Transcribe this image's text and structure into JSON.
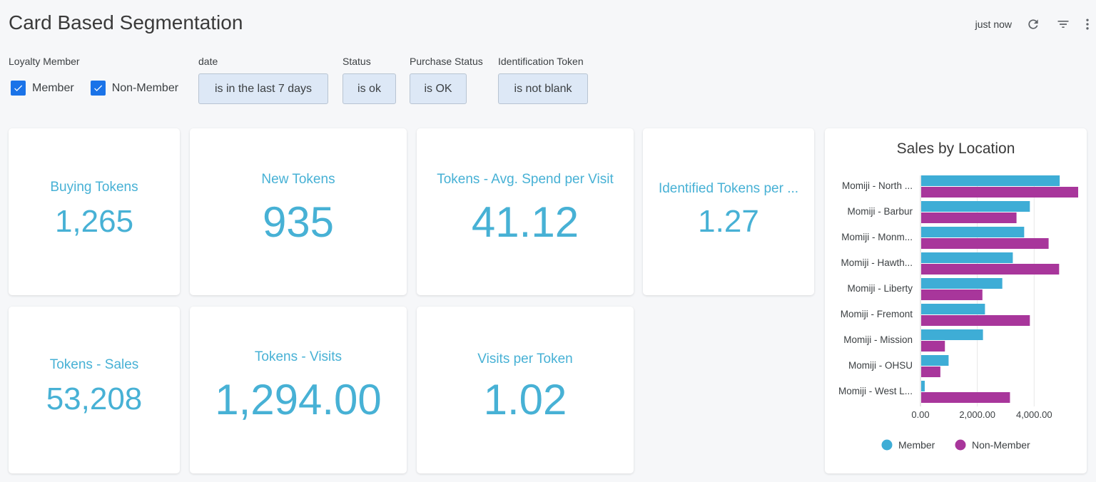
{
  "dashboard": {
    "title": "Card Based Segmentation",
    "updated": "just now",
    "icons": [
      "refresh-icon",
      "filter-icon",
      "more-vert-icon"
    ]
  },
  "filters": {
    "loyalty": {
      "label": "Loyalty Member",
      "options": [
        {
          "label": "Member",
          "checked": true
        },
        {
          "label": "Non-Member",
          "checked": true
        }
      ]
    },
    "date": {
      "label": "date",
      "value": "is in the last 7 days"
    },
    "status": {
      "label": "Status",
      "value": "is ok"
    },
    "purchase_status": {
      "label": "Purchase Status",
      "value": "is OK"
    },
    "identification_token": {
      "label": "Identification Token",
      "value": "is not blank"
    }
  },
  "kpis": {
    "buying_tokens": {
      "title": "Buying Tokens",
      "value": "1,265"
    },
    "new_tokens": {
      "title": "New Tokens",
      "value": "935"
    },
    "avg_spend": {
      "title": "Tokens - Avg. Spend per Visit",
      "value": "41.12"
    },
    "identified_tokens": {
      "title": "Identified Tokens per ...",
      "value": "1.27"
    },
    "sales": {
      "title": "Tokens - Sales",
      "value": "53,208"
    },
    "visits": {
      "title": "Tokens - Visits",
      "value": "1,294.00"
    },
    "visits_per_token": {
      "title": "Visits per Token",
      "value": "1.02"
    }
  },
  "colors": {
    "accent": "#47b1d5",
    "member": "#3eadd6",
    "non_member": "#a8369b",
    "chip_bg": "#dde8f6",
    "checkbox": "#1a73e8"
  },
  "chart_data": {
    "type": "bar",
    "orientation": "horizontal",
    "title": "Sales by Location",
    "categories": [
      "Momiji - North ...",
      "Momiji - Barbur",
      "Momiji - Monm...",
      "Momiji - Hawth...",
      "Momiji - Liberty",
      "Momiji - Fremont",
      "Momiji - Mission",
      "Momiji - OHSU",
      "Momiji - West L..."
    ],
    "series": [
      {
        "name": "Member",
        "color": "#3eadd6",
        "values": [
          4900,
          3850,
          3650,
          3250,
          2880,
          2270,
          2200,
          990,
          150
        ]
      },
      {
        "name": "Non-Member",
        "color": "#a8369b",
        "values": [
          5550,
          3380,
          4510,
          4880,
          2180,
          3850,
          860,
          700,
          3150
        ]
      }
    ],
    "xticks": [
      "0.00",
      "2,000.00",
      "4,000.00"
    ],
    "xlim": [
      0,
      5600
    ],
    "grid": true,
    "legend_position": "bottom"
  }
}
